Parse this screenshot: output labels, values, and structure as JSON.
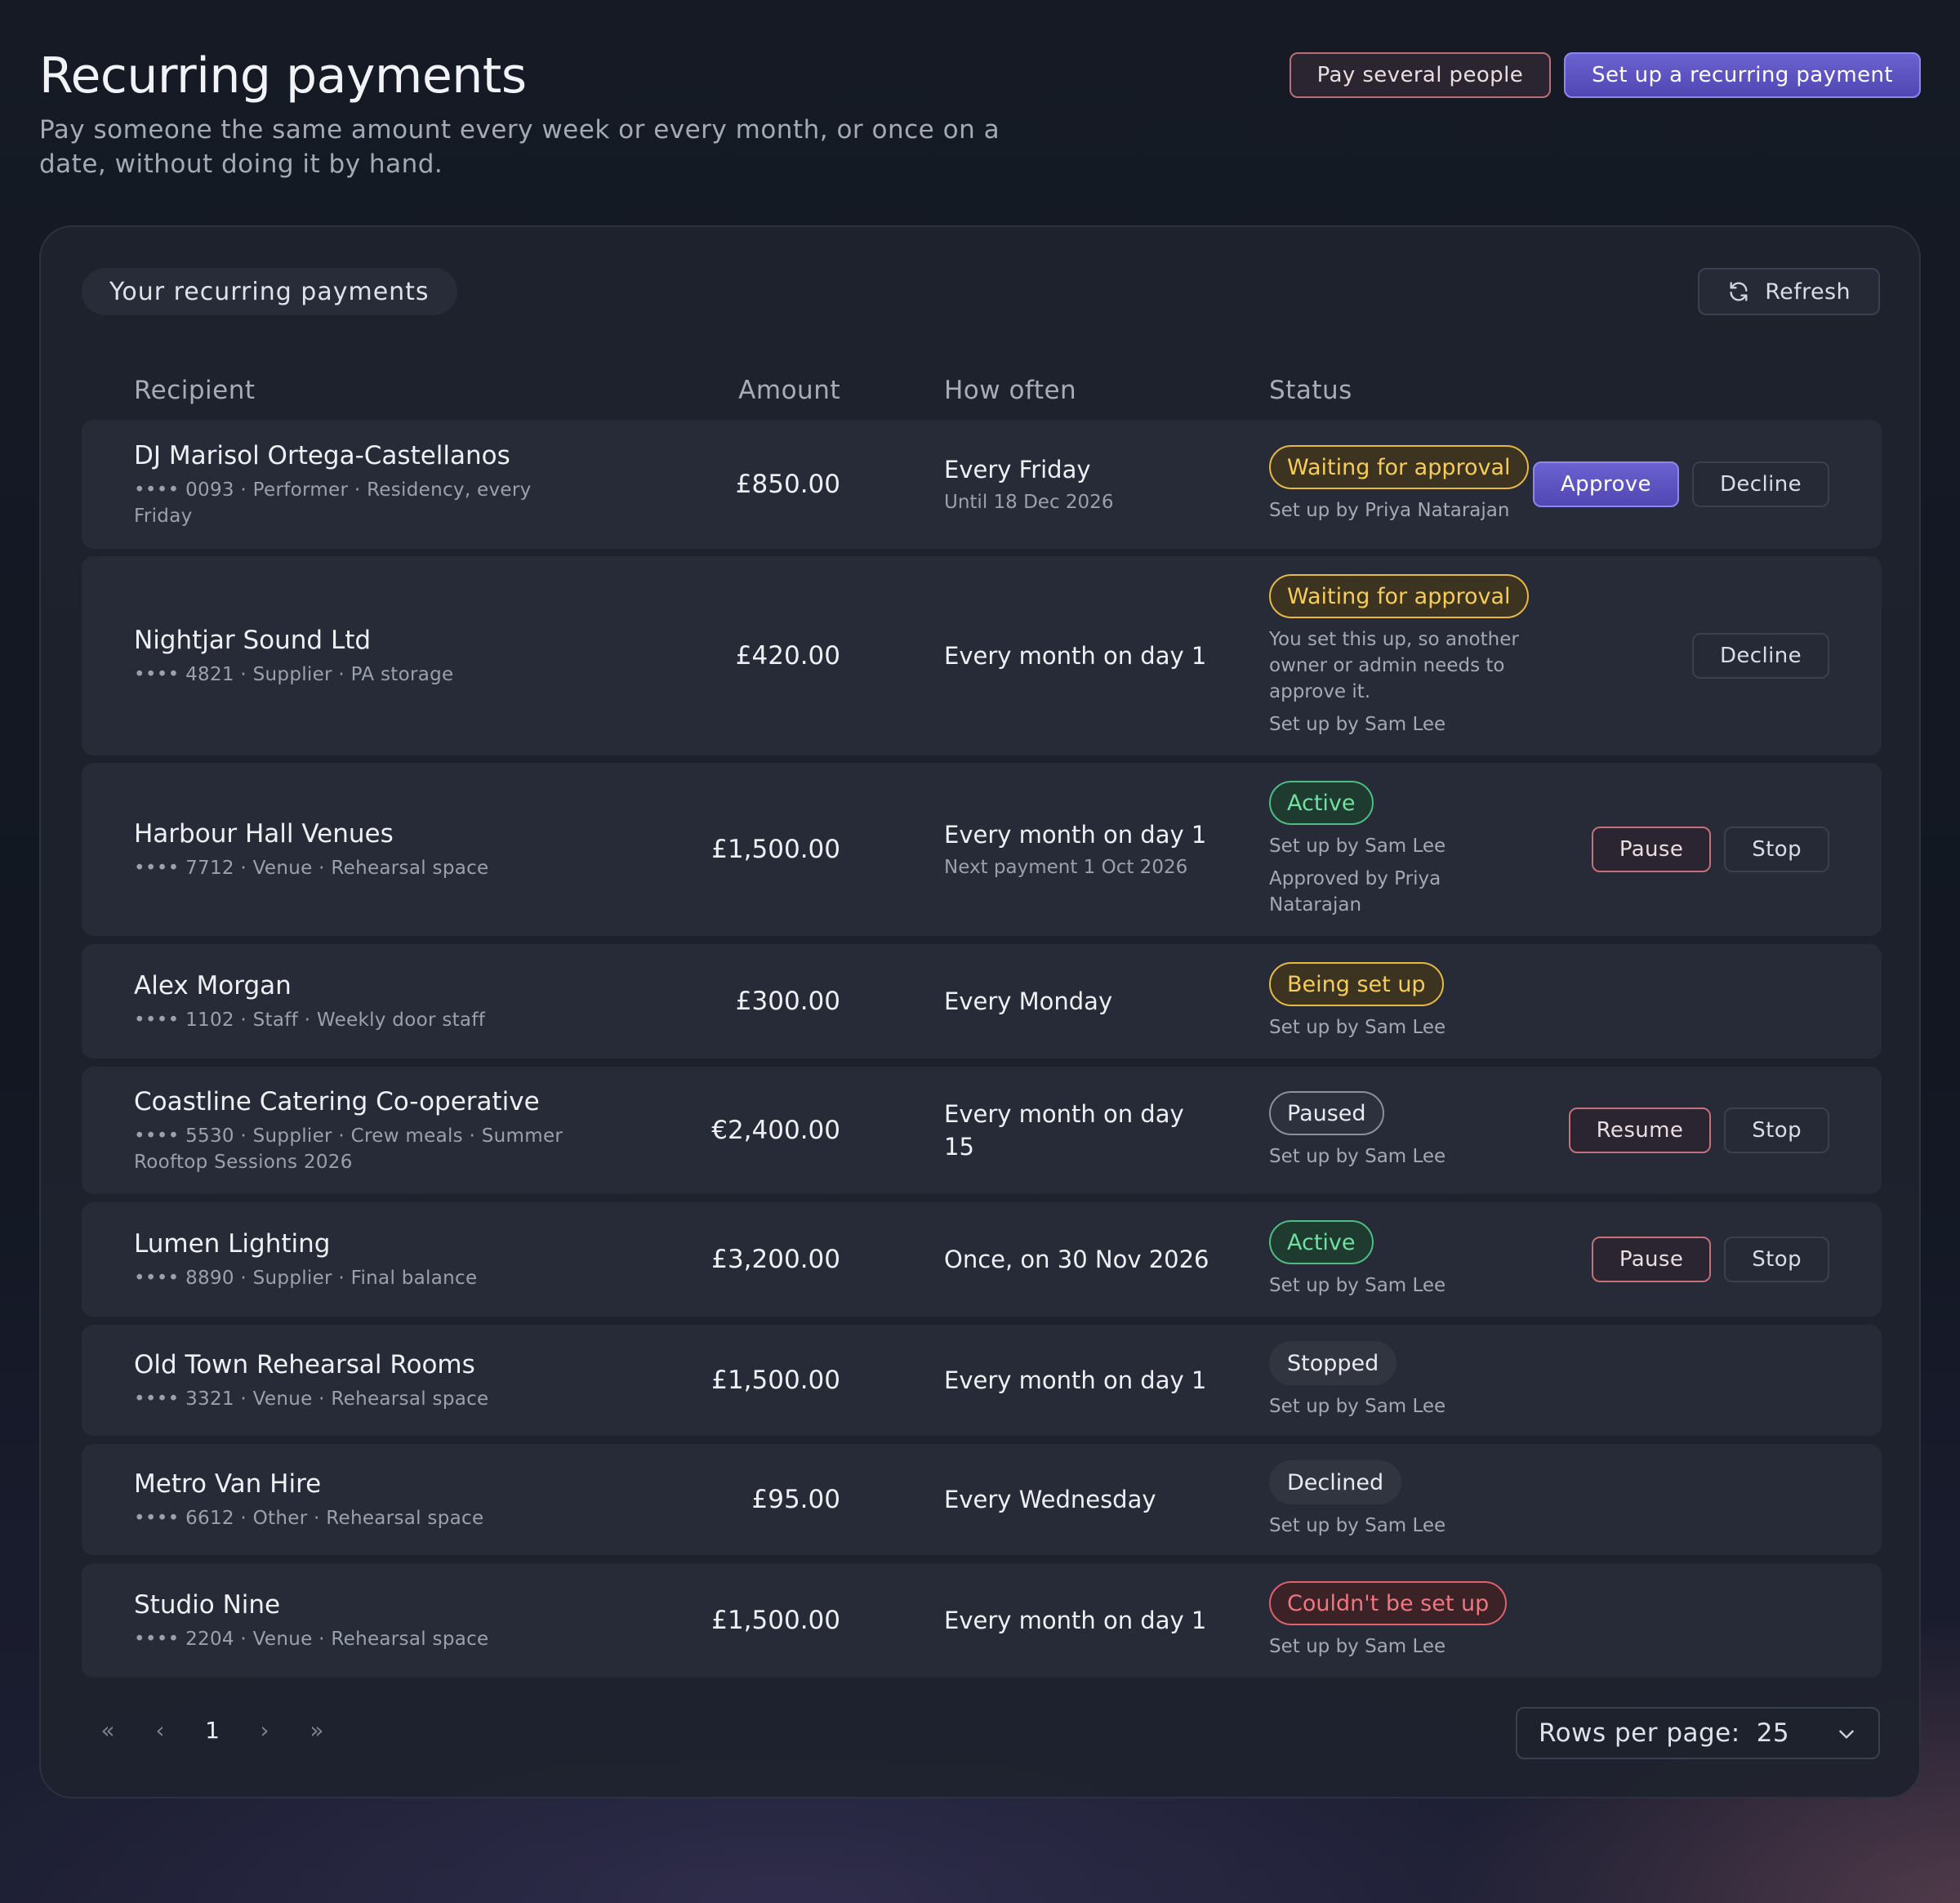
{
  "header": {
    "title": "Recurring payments",
    "subtitle": "Pay someone the same amount every week or every month, or once on a date, without doing it by hand.",
    "pay_several_label": "Pay several people",
    "setup_label": "Set up a recurring payment"
  },
  "card": {
    "label": "Your recurring payments",
    "refresh_label": "Refresh"
  },
  "columns": {
    "recipient": "Recipient",
    "amount": "Amount",
    "how_often": "How often",
    "status": "Status"
  },
  "rows": [
    {
      "name": "DJ Marisol Ortega-Castellanos",
      "meta": "•••• 0093 · Performer · Residency, every Friday",
      "amount": "£850.00",
      "often": "Every Friday",
      "often_sub": "Until 18 Dec 2026",
      "status": "Waiting for approval",
      "notes": [
        "Set up by Priya Natarajan"
      ],
      "actions": [
        "Approve",
        "Decline"
      ]
    },
    {
      "name": "Nightjar Sound Ltd",
      "meta": "•••• 4821 · Supplier · PA storage",
      "amount": "£420.00",
      "often": "Every month on day 1",
      "often_sub": "",
      "status": "Waiting for approval",
      "notes": [
        "You set this up, so another owner or admin needs to approve it.",
        "Set up by Sam Lee"
      ],
      "actions": [
        "Decline"
      ]
    },
    {
      "name": "Harbour Hall Venues",
      "meta": "•••• 7712 · Venue · Rehearsal space",
      "amount": "£1,500.00",
      "often": "Every month on day 1",
      "often_sub": "Next payment 1 Oct 2026",
      "status": "Active",
      "notes": [
        "Set up by Sam Lee",
        "Approved by Priya Natarajan"
      ],
      "actions": [
        "Pause",
        "Stop"
      ]
    },
    {
      "name": "Alex Morgan",
      "meta": "•••• 1102 · Staff · Weekly door staff",
      "amount": "£300.00",
      "often": "Every Monday",
      "often_sub": "",
      "status": "Being set up",
      "notes": [
        "Set up by Sam Lee"
      ],
      "actions": []
    },
    {
      "name": "Coastline Catering Co-operative",
      "meta": "•••• 5530 · Supplier · Crew meals · Summer Rooftop Sessions 2026",
      "amount": "€2,400.00",
      "often": "Every month on day 15",
      "often_sub": "",
      "status": "Paused",
      "notes": [
        "Set up by Sam Lee"
      ],
      "actions": [
        "Resume",
        "Stop"
      ]
    },
    {
      "name": "Lumen Lighting",
      "meta": "•••• 8890 · Supplier · Final balance",
      "amount": "£3,200.00",
      "often": "Once, on 30 Nov 2026",
      "often_sub": "",
      "status": "Active",
      "notes": [
        "Set up by Sam Lee"
      ],
      "actions": [
        "Pause",
        "Stop"
      ]
    },
    {
      "name": "Old Town Rehearsal Rooms",
      "meta": "•••• 3321 · Venue · Rehearsal space",
      "amount": "£1,500.00",
      "often": "Every month on day 1",
      "often_sub": "",
      "status": "Stopped",
      "notes": [
        "Set up by Sam Lee"
      ],
      "actions": []
    },
    {
      "name": "Metro Van Hire",
      "meta": "•••• 6612 · Other · Rehearsal space",
      "amount": "£95.00",
      "often": "Every Wednesday",
      "often_sub": "",
      "status": "Declined",
      "notes": [
        "Set up by Sam Lee"
      ],
      "actions": []
    },
    {
      "name": "Studio Nine",
      "meta": "•••• 2204 · Venue · Rehearsal space",
      "amount": "£1,500.00",
      "often": "Every month on day 1",
      "often_sub": "",
      "status": "Couldn't be set up",
      "notes": [
        "Set up by Sam Lee"
      ],
      "actions": []
    }
  ],
  "pagination": {
    "first": "«",
    "prev": "‹",
    "current": "1",
    "next": "›",
    "last": "»"
  },
  "rows_per_page": {
    "label": "Rows per page:",
    "value": "25"
  },
  "icons": {
    "refresh": "refresh-icon",
    "chevron": "chevron-down-icon"
  }
}
